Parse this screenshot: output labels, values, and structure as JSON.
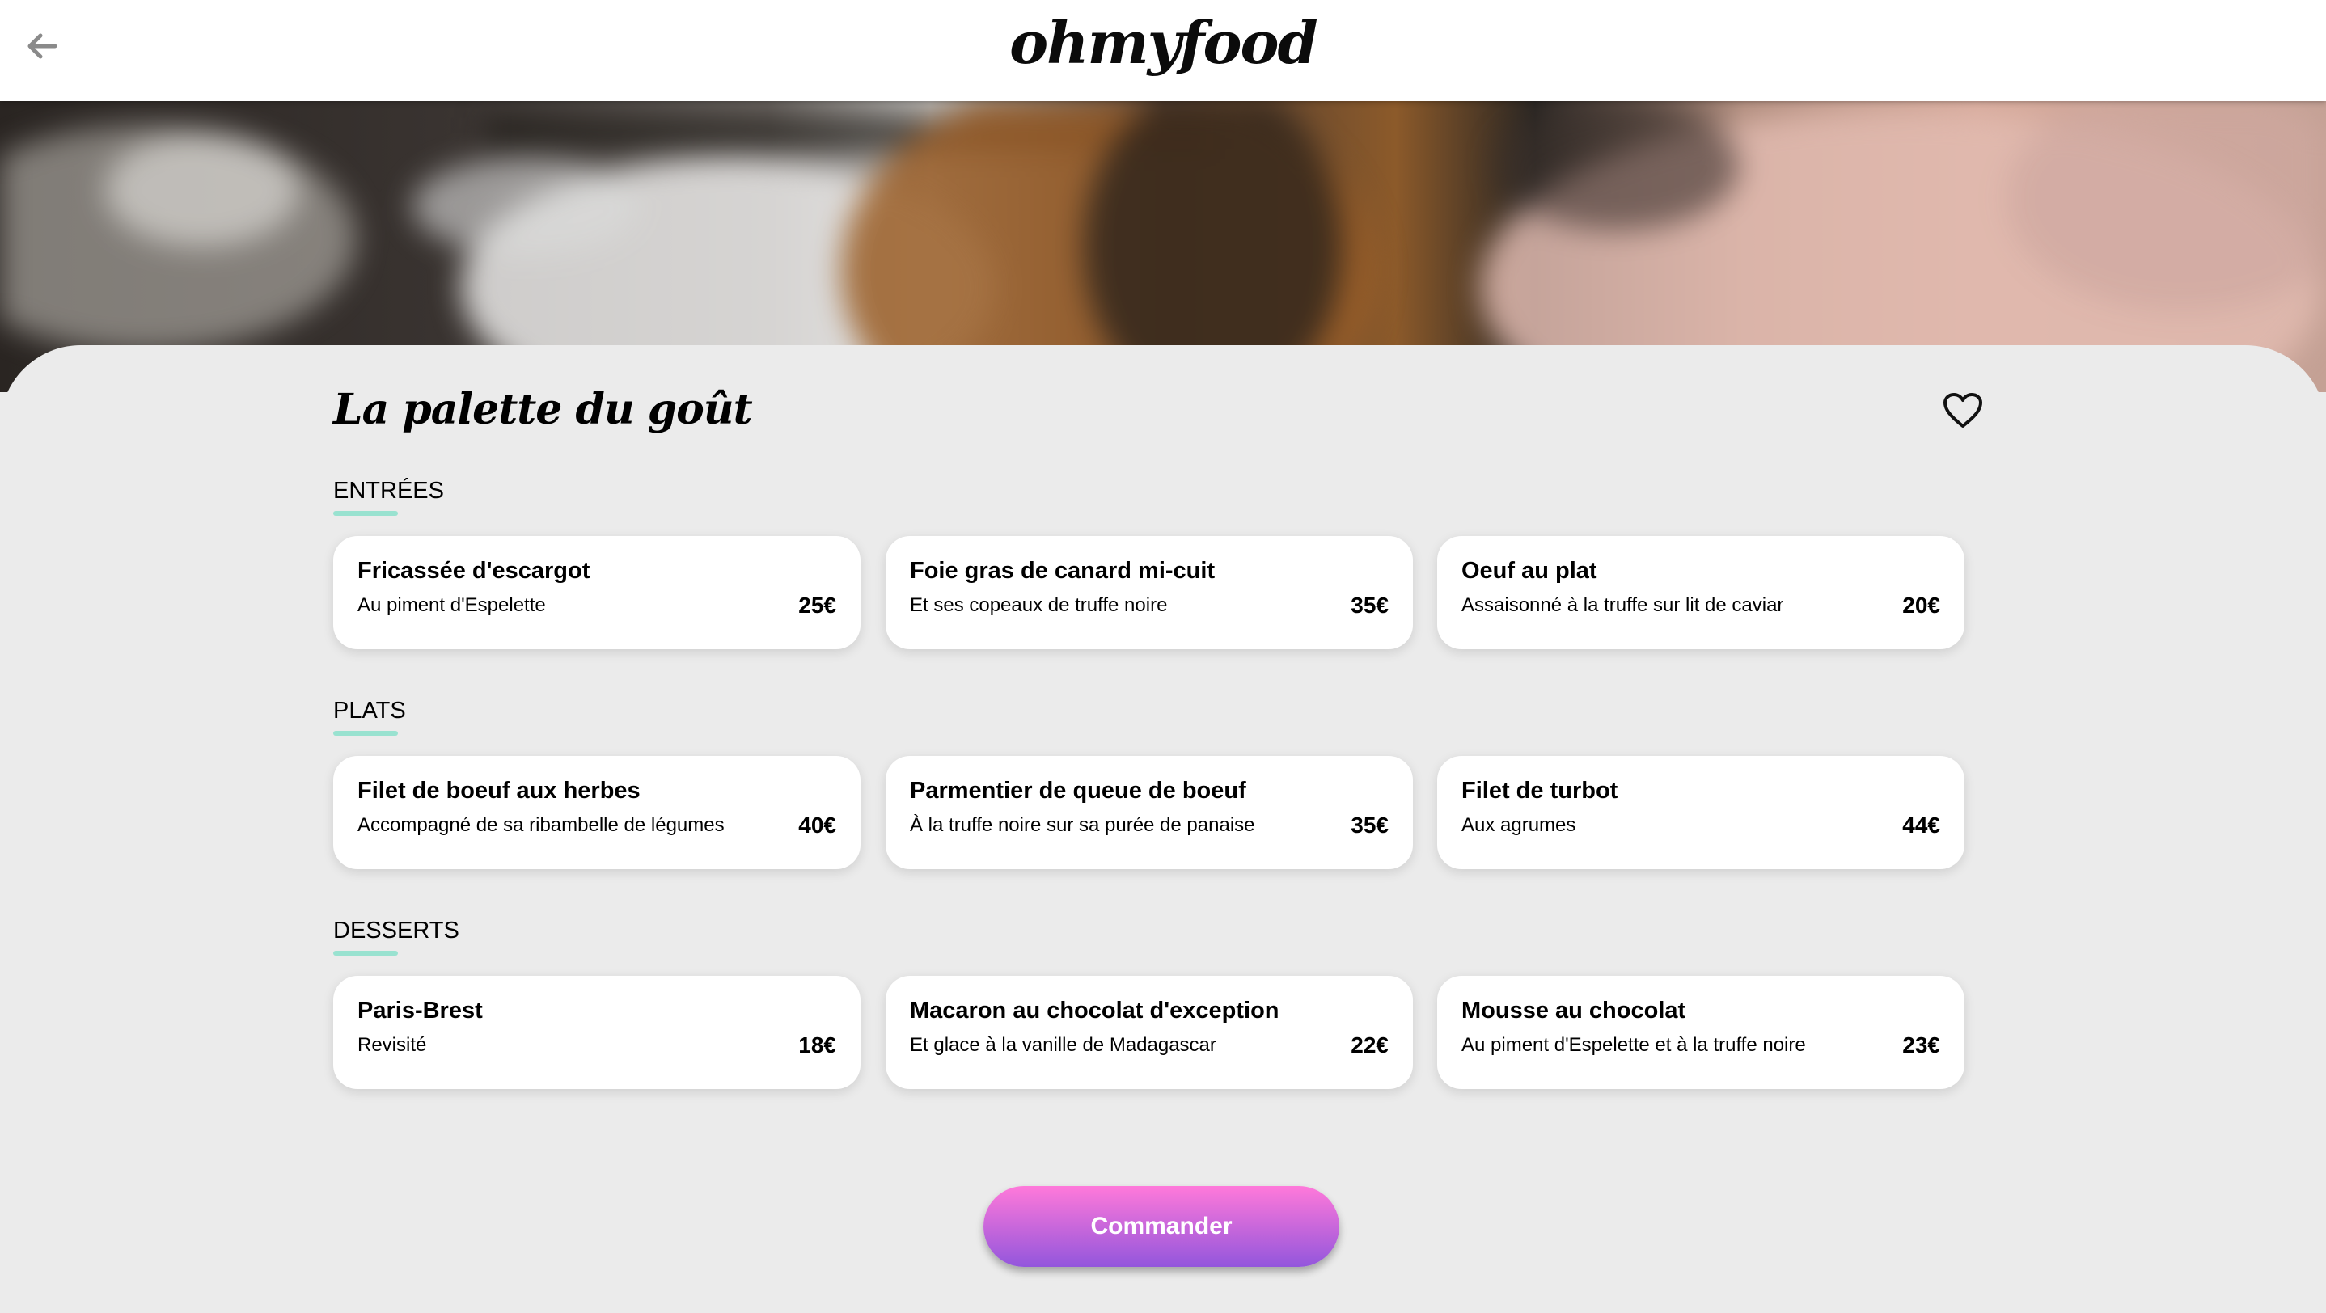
{
  "header": {
    "logo": "ohmyfood",
    "back_icon": "arrow-left-icon"
  },
  "restaurant": {
    "title": "La palette du goût",
    "favorite_icon": "heart-outline-icon"
  },
  "sections": [
    {
      "title": "ENTRÉES",
      "items": [
        {
          "name": "Fricassée d'escargot",
          "desc": "Au piment d'Espelette",
          "price": "25€"
        },
        {
          "name": "Foie gras de canard mi-cuit",
          "desc": "Et ses copeaux de truffe noire",
          "price": "35€"
        },
        {
          "name": "Oeuf au plat",
          "desc": "Assaisonné à la truffe sur lit de caviar",
          "price": "20€"
        }
      ]
    },
    {
      "title": "PLATS",
      "items": [
        {
          "name": "Filet de boeuf aux herbes",
          "desc": "Accompagné de sa ribambelle de légumes",
          "price": "40€"
        },
        {
          "name": "Parmentier de queue de boeuf",
          "desc": "À la truffe noire sur sa purée de panaise",
          "price": "35€"
        },
        {
          "name": "Filet de turbot",
          "desc": "Aux agrumes",
          "price": "44€"
        }
      ]
    },
    {
      "title": "DESSERTS",
      "items": [
        {
          "name": "Paris-Brest",
          "desc": "Revisité",
          "price": "18€"
        },
        {
          "name": "Macaron au chocolat d'exception",
          "desc": "Et glace à la vanille de Madagascar",
          "price": "22€"
        },
        {
          "name": "Mousse au chocolat",
          "desc": "Au piment d'Espelette et à la truffe noire",
          "price": "23€"
        }
      ]
    }
  ],
  "order_button": "Commander",
  "colors": {
    "accent_underline": "#99e2d0",
    "button_gradient_top": "#ff79da",
    "button_gradient_bottom": "#9356dc",
    "background": "#ebebeb"
  }
}
